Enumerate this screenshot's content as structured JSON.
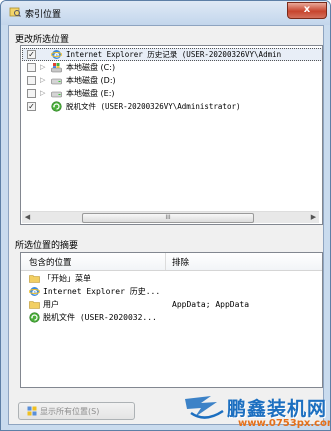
{
  "window": {
    "title": "索引位置",
    "close_label": "x"
  },
  "top_section": {
    "label": "更改所选位置",
    "items": [
      {
        "checked": true,
        "expandable": false,
        "icon": "ie-icon",
        "text": "Internet Explorer 历史记录 (USER-20200326VY\\Admin",
        "selected": true
      },
      {
        "checked": false,
        "expandable": true,
        "icon": "system-drive-icon",
        "text": "本地磁盘 (C:)"
      },
      {
        "checked": false,
        "expandable": true,
        "icon": "drive-icon",
        "text": "本地磁盘 (D:)"
      },
      {
        "checked": false,
        "expandable": true,
        "icon": "drive-icon",
        "text": "本地磁盘 (E:)"
      },
      {
        "checked": true,
        "expandable": false,
        "icon": "offline-files-icon",
        "text": "脱机文件 (USER-20200326VY\\Administrator)"
      }
    ],
    "scrollbar": {
      "left_arrow": "◀",
      "right_arrow": "▶",
      "grip": "III"
    }
  },
  "summary_section": {
    "label": "所选位置的摘要",
    "columns": {
      "included": "包含的位置",
      "excluded": "排除"
    },
    "rows": [
      {
        "icon": "folder-icon",
        "location": "「开始」菜单",
        "exclude": ""
      },
      {
        "icon": "ie-icon",
        "location": "Internet Explorer 历史...",
        "exclude": ""
      },
      {
        "icon": "folder-icon",
        "location": "用户",
        "exclude": "AppData; AppData"
      },
      {
        "icon": "offline-files-icon",
        "location": "脱机文件 (USER-2020032...",
        "exclude": ""
      }
    ]
  },
  "show_all_button": {
    "label": "显示所有位置(S)",
    "icon": "shield-icon"
  },
  "watermark": {
    "brand": "鹏鑫装机网",
    "url": "www.0753px.com"
  },
  "colors": {
    "accent": "#1c6fc0",
    "url": "#e5701a",
    "title_bar": "#c9dbee"
  }
}
